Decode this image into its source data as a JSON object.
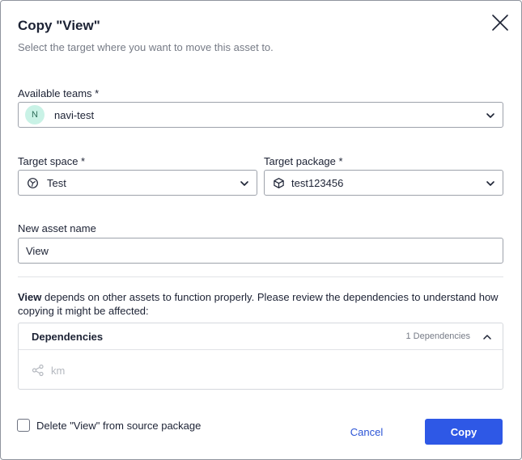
{
  "dialog": {
    "title": "Copy \"View\"",
    "subtitle": "Select the target where you want to move this asset to."
  },
  "teams": {
    "label": "Available teams *",
    "avatar_initial": "N",
    "value": "navi-test"
  },
  "space": {
    "label": "Target space *",
    "value": "Test"
  },
  "package": {
    "label": "Target package *",
    "value": "test123456"
  },
  "asset_name": {
    "label": "New asset name",
    "value": "View"
  },
  "description": {
    "bold": "View",
    "text": " depends on other assets to function properly. Please review the dependencies to understand how copying it might be affected:"
  },
  "dependencies": {
    "title": "Dependencies",
    "count": "1 Dependencies",
    "items": [
      {
        "label": "km"
      }
    ]
  },
  "footer": {
    "delete_label": "Delete \"View\" from source package",
    "cancel_label": "Cancel",
    "copy_label": "Copy"
  },
  "colors": {
    "primary": "#2e58e6",
    "link": "#2b54d6",
    "avatar_bg": "#c9f2e6"
  }
}
